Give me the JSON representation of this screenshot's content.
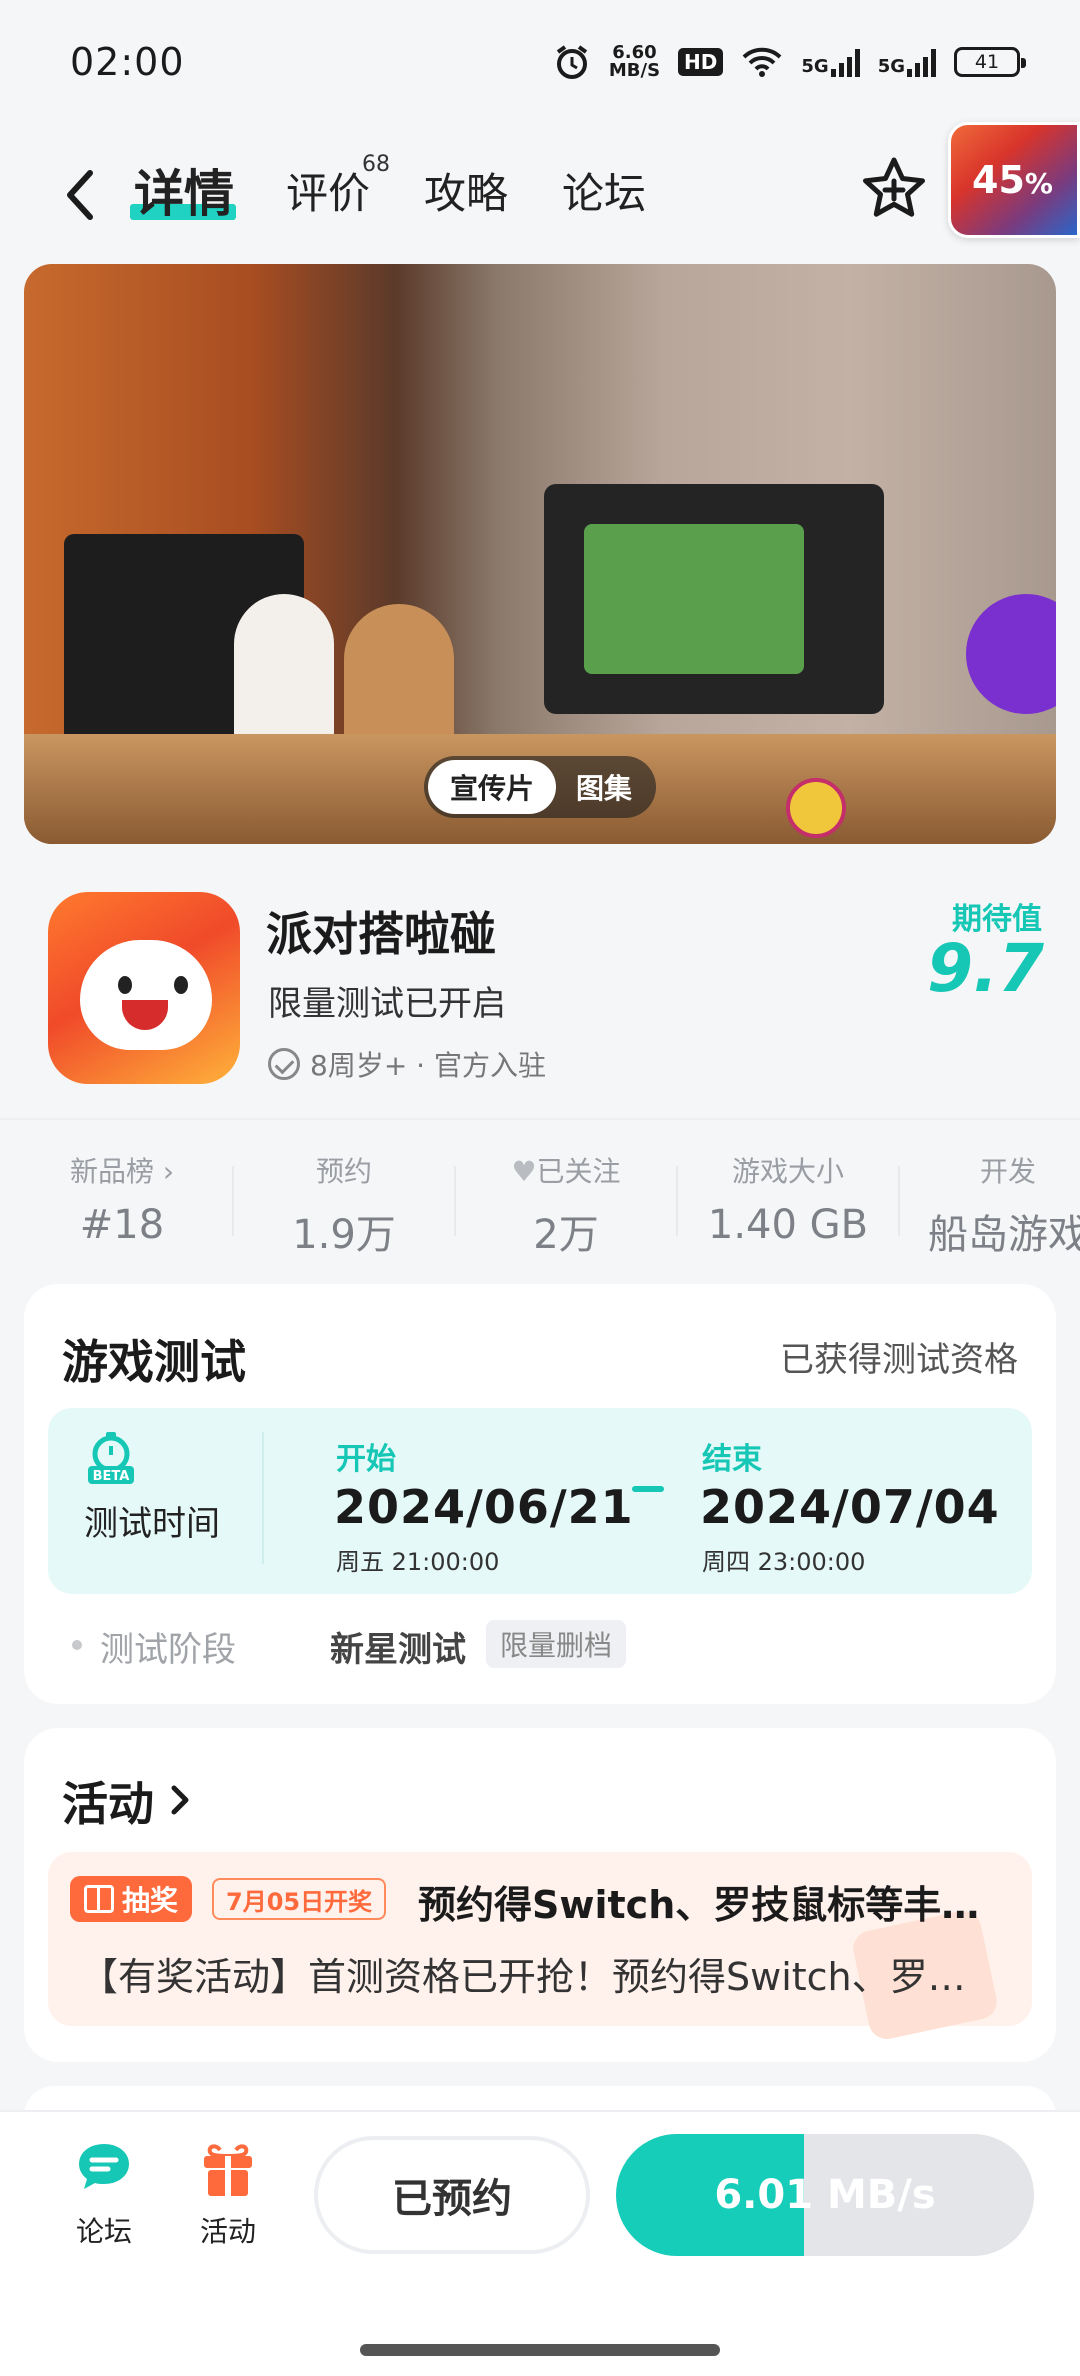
{
  "status_bar": {
    "time": "02:00",
    "net_speed_value": "6.60",
    "net_speed_unit": "MB/S",
    "hd_label": "HD",
    "signal1": "5G",
    "signal2": "5G",
    "battery": "41"
  },
  "nav": {
    "tabs": [
      {
        "label": "详情"
      },
      {
        "label": "评价"
      },
      {
        "label": "攻略"
      },
      {
        "label": "论坛"
      }
    ],
    "review_count": "68",
    "download_percent": "45",
    "download_percent_sign": "%"
  },
  "hero": {
    "media_tabs": [
      "宣传片",
      "图集"
    ]
  },
  "game": {
    "title": "派对搭啦碰",
    "subtitle": "限量测试已开启",
    "meta": "8周岁+ · 官方入驻",
    "expect_label": "期待值",
    "expect_value": "9.7"
  },
  "stats": [
    {
      "label": "新品榜 ›",
      "value": "#18"
    },
    {
      "label": "预约",
      "value": "1.9万"
    },
    {
      "label": "已关注",
      "value": "2万"
    },
    {
      "label": "游戏大小",
      "value": "1.40 GB"
    },
    {
      "label": "开发",
      "value": "船岛游戏"
    }
  ],
  "test": {
    "title": "游戏测试",
    "qualification": "已获得测试资格",
    "time_label": "测试时间",
    "start_label": "开始",
    "start_date": "2024/06/21",
    "start_week": "周五  21:00:00",
    "end_label": "结束",
    "end_date": "2024/07/04",
    "end_week": "周四  23:00:00",
    "stage_label": "测试阶段",
    "stage_value": "新星测试",
    "stage_tag": "限量删档"
  },
  "activity": {
    "title": "活动",
    "lottery_tag": "抽奖",
    "date_tag": "7月05日开奖",
    "headline": "预约得Switch、罗技鼠标等丰厚好礼",
    "description": "【有奖活动】首测资格已开抢！预约得Switch、罗技鼠标等好礼"
  },
  "bottom_bar": {
    "forum_label": "论坛",
    "activity_label": "活动",
    "reserved_label": "已预约",
    "download_speed": "6.01 MB/s",
    "download_progress": 0.45
  },
  "colors": {
    "accent": "#16c7b5",
    "activity_orange": "#ff6a3d"
  }
}
